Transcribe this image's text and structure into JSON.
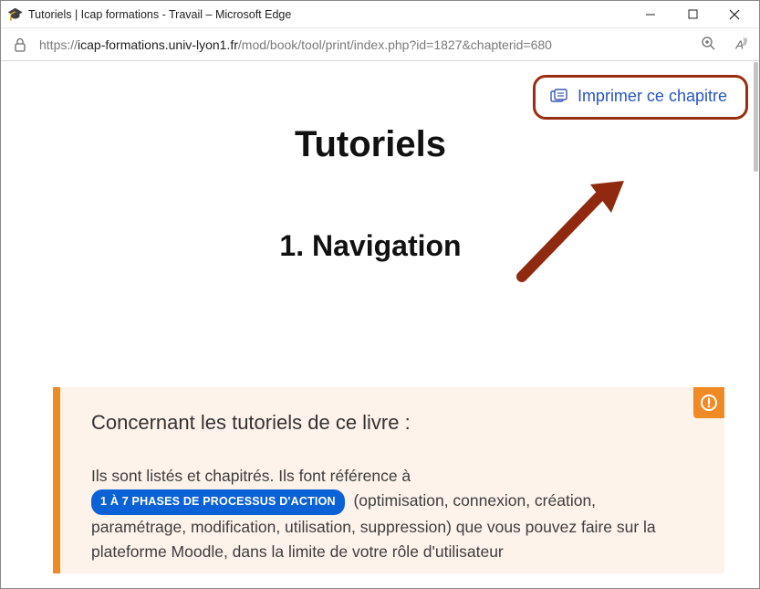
{
  "window": {
    "title": "Tutoriels | Icap formations - Travail – Microsoft Edge"
  },
  "address": {
    "host": "icap-formations.univ-lyon1.fr",
    "scheme": "https://",
    "path": "/mod/book/tool/print/index.php?id=1827&chapterid=680"
  },
  "print_link": {
    "label": "Imprimer ce chapitre"
  },
  "content": {
    "page_title": "Tutoriels",
    "chapter_title": "1. Navigation",
    "info_title": "Concernant les tutoriels de ce livre :",
    "info_line1": "Ils sont listés et chapitrés. Ils font référence à",
    "pill_text": "1 À 7 PHASES DE PROCESSUS D'ACTION",
    "info_tail": "(optimisation, connexion, création, paramétrage, modification, utilisation, suppression) que vous pouvez faire sur la plateforme Moodle, dans la limite de votre rôle d'utilisateur"
  }
}
